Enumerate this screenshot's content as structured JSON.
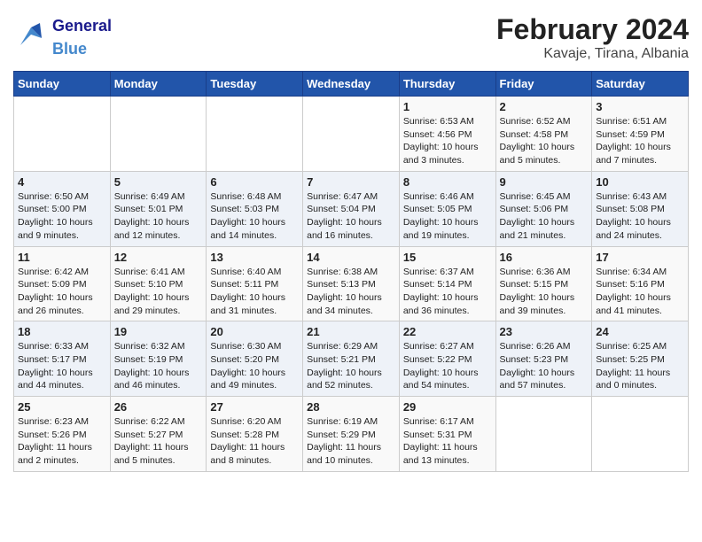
{
  "logo": {
    "general": "General",
    "blue": "Blue"
  },
  "title": "February 2024",
  "subtitle": "Kavaje, Tirana, Albania",
  "days_of_week": [
    "Sunday",
    "Monday",
    "Tuesday",
    "Wednesday",
    "Thursday",
    "Friday",
    "Saturday"
  ],
  "weeks": [
    [
      {
        "day": "",
        "info": ""
      },
      {
        "day": "",
        "info": ""
      },
      {
        "day": "",
        "info": ""
      },
      {
        "day": "",
        "info": ""
      },
      {
        "day": "1",
        "info": "Sunrise: 6:53 AM\nSunset: 4:56 PM\nDaylight: 10 hours\nand 3 minutes."
      },
      {
        "day": "2",
        "info": "Sunrise: 6:52 AM\nSunset: 4:58 PM\nDaylight: 10 hours\nand 5 minutes."
      },
      {
        "day": "3",
        "info": "Sunrise: 6:51 AM\nSunset: 4:59 PM\nDaylight: 10 hours\nand 7 minutes."
      }
    ],
    [
      {
        "day": "4",
        "info": "Sunrise: 6:50 AM\nSunset: 5:00 PM\nDaylight: 10 hours\nand 9 minutes."
      },
      {
        "day": "5",
        "info": "Sunrise: 6:49 AM\nSunset: 5:01 PM\nDaylight: 10 hours\nand 12 minutes."
      },
      {
        "day": "6",
        "info": "Sunrise: 6:48 AM\nSunset: 5:03 PM\nDaylight: 10 hours\nand 14 minutes."
      },
      {
        "day": "7",
        "info": "Sunrise: 6:47 AM\nSunset: 5:04 PM\nDaylight: 10 hours\nand 16 minutes."
      },
      {
        "day": "8",
        "info": "Sunrise: 6:46 AM\nSunset: 5:05 PM\nDaylight: 10 hours\nand 19 minutes."
      },
      {
        "day": "9",
        "info": "Sunrise: 6:45 AM\nSunset: 5:06 PM\nDaylight: 10 hours\nand 21 minutes."
      },
      {
        "day": "10",
        "info": "Sunrise: 6:43 AM\nSunset: 5:08 PM\nDaylight: 10 hours\nand 24 minutes."
      }
    ],
    [
      {
        "day": "11",
        "info": "Sunrise: 6:42 AM\nSunset: 5:09 PM\nDaylight: 10 hours\nand 26 minutes."
      },
      {
        "day": "12",
        "info": "Sunrise: 6:41 AM\nSunset: 5:10 PM\nDaylight: 10 hours\nand 29 minutes."
      },
      {
        "day": "13",
        "info": "Sunrise: 6:40 AM\nSunset: 5:11 PM\nDaylight: 10 hours\nand 31 minutes."
      },
      {
        "day": "14",
        "info": "Sunrise: 6:38 AM\nSunset: 5:13 PM\nDaylight: 10 hours\nand 34 minutes."
      },
      {
        "day": "15",
        "info": "Sunrise: 6:37 AM\nSunset: 5:14 PM\nDaylight: 10 hours\nand 36 minutes."
      },
      {
        "day": "16",
        "info": "Sunrise: 6:36 AM\nSunset: 5:15 PM\nDaylight: 10 hours\nand 39 minutes."
      },
      {
        "day": "17",
        "info": "Sunrise: 6:34 AM\nSunset: 5:16 PM\nDaylight: 10 hours\nand 41 minutes."
      }
    ],
    [
      {
        "day": "18",
        "info": "Sunrise: 6:33 AM\nSunset: 5:17 PM\nDaylight: 10 hours\nand 44 minutes."
      },
      {
        "day": "19",
        "info": "Sunrise: 6:32 AM\nSunset: 5:19 PM\nDaylight: 10 hours\nand 46 minutes."
      },
      {
        "day": "20",
        "info": "Sunrise: 6:30 AM\nSunset: 5:20 PM\nDaylight: 10 hours\nand 49 minutes."
      },
      {
        "day": "21",
        "info": "Sunrise: 6:29 AM\nSunset: 5:21 PM\nDaylight: 10 hours\nand 52 minutes."
      },
      {
        "day": "22",
        "info": "Sunrise: 6:27 AM\nSunset: 5:22 PM\nDaylight: 10 hours\nand 54 minutes."
      },
      {
        "day": "23",
        "info": "Sunrise: 6:26 AM\nSunset: 5:23 PM\nDaylight: 10 hours\nand 57 minutes."
      },
      {
        "day": "24",
        "info": "Sunrise: 6:25 AM\nSunset: 5:25 PM\nDaylight: 11 hours\nand 0 minutes."
      }
    ],
    [
      {
        "day": "25",
        "info": "Sunrise: 6:23 AM\nSunset: 5:26 PM\nDaylight: 11 hours\nand 2 minutes."
      },
      {
        "day": "26",
        "info": "Sunrise: 6:22 AM\nSunset: 5:27 PM\nDaylight: 11 hours\nand 5 minutes."
      },
      {
        "day": "27",
        "info": "Sunrise: 6:20 AM\nSunset: 5:28 PM\nDaylight: 11 hours\nand 8 minutes."
      },
      {
        "day": "28",
        "info": "Sunrise: 6:19 AM\nSunset: 5:29 PM\nDaylight: 11 hours\nand 10 minutes."
      },
      {
        "day": "29",
        "info": "Sunrise: 6:17 AM\nSunset: 5:31 PM\nDaylight: 11 hours\nand 13 minutes."
      },
      {
        "day": "",
        "info": ""
      },
      {
        "day": "",
        "info": ""
      }
    ]
  ]
}
